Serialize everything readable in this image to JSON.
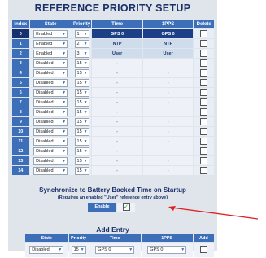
{
  "title": "REFERENCE PRIORITY SETUP",
  "table": {
    "headers": [
      "Index",
      "State",
      "Priority",
      "Time",
      "1PPS",
      "Delete"
    ],
    "rows": [
      {
        "index": "0",
        "state": "Enabled",
        "priority": "1",
        "time": "GPS 0",
        "pps": "GPS 0",
        "selected": true
      },
      {
        "index": "1",
        "state": "Enabled",
        "priority": "2",
        "time": "NTP",
        "pps": "NTP",
        "selected": false
      },
      {
        "index": "2",
        "state": "Enabled",
        "priority": "3",
        "time": "User",
        "pps": "User",
        "selected": false
      },
      {
        "index": "3",
        "state": "Disabled",
        "priority": "15",
        "time": "-",
        "pps": "-",
        "selected": false
      },
      {
        "index": "4",
        "state": "Disabled",
        "priority": "15",
        "time": "-",
        "pps": "-",
        "selected": false
      },
      {
        "index": "5",
        "state": "Disabled",
        "priority": "15",
        "time": "-",
        "pps": "-",
        "selected": false
      },
      {
        "index": "6",
        "state": "Disabled",
        "priority": "15",
        "time": "-",
        "pps": "-",
        "selected": false
      },
      {
        "index": "7",
        "state": "Disabled",
        "priority": "15",
        "time": "-",
        "pps": "-",
        "selected": false
      },
      {
        "index": "8",
        "state": "Disabled",
        "priority": "15",
        "time": "-",
        "pps": "-",
        "selected": false
      },
      {
        "index": "9",
        "state": "Disabled",
        "priority": "15",
        "time": "-",
        "pps": "-",
        "selected": false
      },
      {
        "index": "10",
        "state": "Disabled",
        "priority": "15",
        "time": "-",
        "pps": "-",
        "selected": false
      },
      {
        "index": "11",
        "state": "Disabled",
        "priority": "15",
        "time": "-",
        "pps": "-",
        "selected": false
      },
      {
        "index": "12",
        "state": "Disabled",
        "priority": "15",
        "time": "-",
        "pps": "-",
        "selected": false
      },
      {
        "index": "13",
        "state": "Disabled",
        "priority": "15",
        "time": "-",
        "pps": "-",
        "selected": false
      },
      {
        "index": "14",
        "state": "Disabled",
        "priority": "15",
        "time": "-",
        "pps": "-",
        "selected": false
      }
    ]
  },
  "sync": {
    "title": "Synchronize to Battery Backed Time on Startup",
    "subtitle": "(Requires an enabled \"User\" reference entry above)",
    "enable_label": "Enable",
    "enabled": true
  },
  "add_entry": {
    "title": "Add Entry",
    "headers": [
      "State",
      "Priority",
      "Time",
      "1PPS",
      "Add"
    ],
    "state": "Disabled",
    "priority": "15",
    "time": "GPS 0",
    "pps": "GPS 0"
  },
  "colors": {
    "header_blue": "#3d6fb9",
    "selected_dark": "#1c4088",
    "title_navy": "#1b2f68",
    "annotation_red": "#e02020"
  }
}
